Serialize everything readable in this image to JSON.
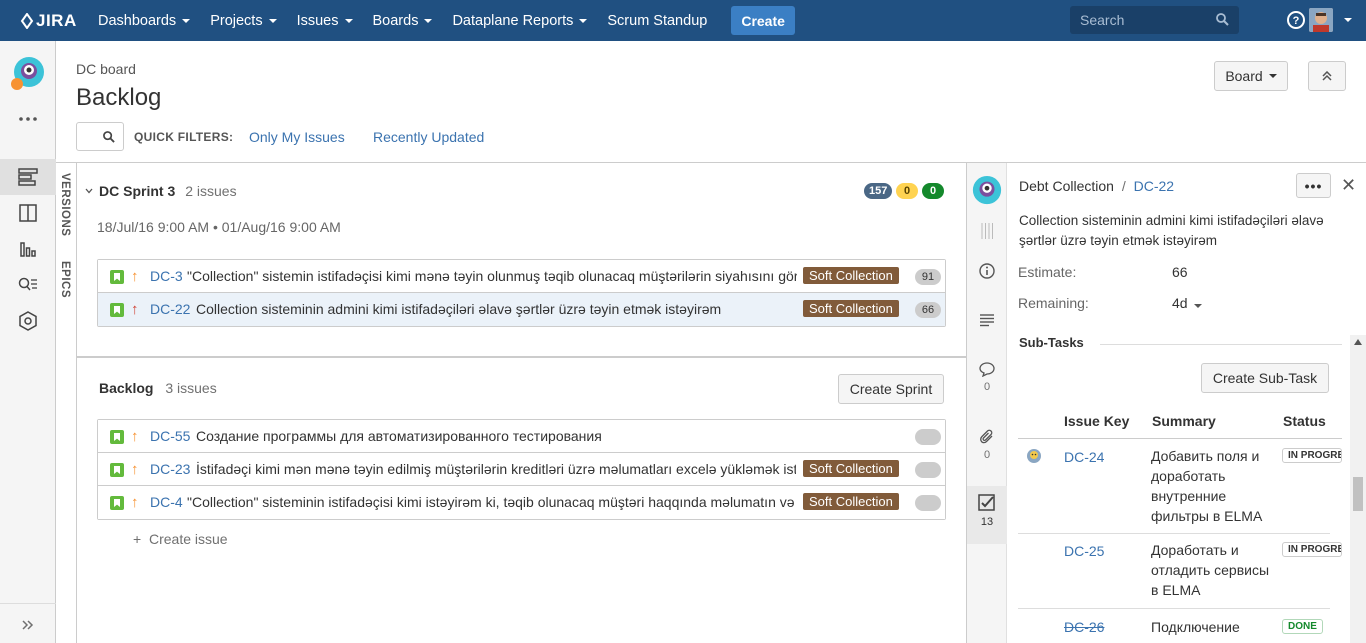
{
  "topnav": {
    "logo": "JIRA",
    "items": [
      "Dashboards",
      "Projects",
      "Issues",
      "Boards",
      "Dataplane Reports",
      "Scrum Standup"
    ],
    "create": "Create",
    "search_placeholder": "Search",
    "help_label": "?"
  },
  "header": {
    "crumb": "DC board",
    "title": "Backlog",
    "quick_filters_label": "QUICK FILTERS:",
    "filters": [
      "Only My Issues",
      "Recently Updated"
    ],
    "board_button": "Board"
  },
  "vtabs": [
    "VERSIONS",
    "EPICS"
  ],
  "sprint": {
    "name": "DC Sprint 3",
    "count": "2 issues",
    "dates": "18/Jul/16 9:00 AM • 01/Aug/16 9:00 AM",
    "badges": [
      "157",
      "0",
      "0"
    ],
    "issues": [
      {
        "key": "DC-3",
        "summary": "\"Collection\" sistemin istifadəçisi kimi mənə təyin olunmuş təqib olunacaq müştərilərin siyahısını görmək istəyirəm",
        "epic": "Soft Collection",
        "estimate": "91",
        "priority": "↑"
      },
      {
        "key": "DC-22",
        "summary": "Collection sisteminin admini kimi istifadəçiləri əlavə şərtlər üzrə təyin etmək istəyirəm",
        "epic": "Soft Collection",
        "estimate": "66",
        "priority": "↑"
      }
    ]
  },
  "backlog": {
    "name": "Backlog",
    "count": "3 issues",
    "create_sprint": "Create Sprint",
    "issues": [
      {
        "key": "DC-55",
        "summary": "Создание программы для автоматизированного тестирования",
        "epic": "",
        "priority": "↑"
      },
      {
        "key": "DC-23",
        "summary": "İstifadəçi kimi mən mənə təyin edilmiş müştərilərin kreditləri üzrə məlumatları excelə yükləmək istəyirəm",
        "epic": "Soft Collection",
        "priority": "↑"
      },
      {
        "key": "DC-4",
        "summary": "\"Collection\" sisteminin istifadəçisi kimi istəyirəm ki, təqib olunacaq müştəri haqqında məlumatın və sənədlərin siyahısını görə bilim",
        "epic": "Soft Collection",
        "priority": "↑"
      }
    ],
    "create_issue": "Create issue"
  },
  "detail": {
    "project": "Debt Collection",
    "separator": "/",
    "key": "DC-22",
    "more": "•••",
    "close": "✕",
    "summary": "Collection sisteminin admini kimi istifadəçiləri əlavə şərtlər üzrə təyin etmək istəyirəm",
    "estimate_label": "Estimate:",
    "estimate_value": "66",
    "remaining_label": "Remaining:",
    "remaining_value": "4d",
    "subtasks_title": "Sub-Tasks",
    "create_subtask": "Create Sub-Task",
    "columns": [
      "Issue Key",
      "Summary",
      "Status"
    ],
    "subtasks": [
      {
        "key": "DC-24",
        "summary": "Добавить поля и доработать внутренние фильтры в ELMA",
        "status": "IN PROGRESS"
      },
      {
        "key": "DC-25",
        "summary": "Доработать и отладить сервисы в ELMA",
        "status": "IN PROGRESS"
      },
      {
        "key": "DC-26",
        "summary": "Подключение",
        "status": "DONE"
      }
    ],
    "rail_counts": {
      "comments": "0",
      "attachments": "0",
      "subtasks": "13"
    }
  },
  "colors": {
    "nav": "#205081",
    "link": "#3b73af",
    "epic": "#815b3a",
    "story": "#63ba3c"
  }
}
